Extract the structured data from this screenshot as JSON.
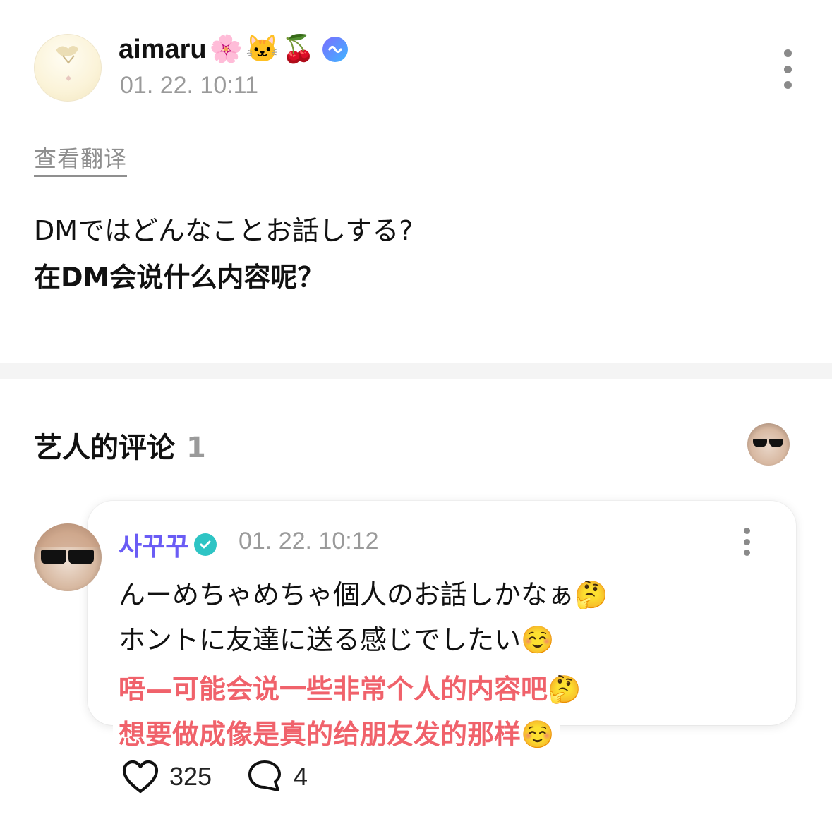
{
  "post": {
    "author_name": "aimaru",
    "author_emojis": [
      "🌸",
      "🐱",
      "🍒"
    ],
    "timestamp": "01. 22. 10:11",
    "translate_link": "查看翻译",
    "text_original": "DMではどんなことお話しする?",
    "text_translation": "在DM会说什么内容呢？"
  },
  "artist_comments": {
    "title": "艺人的评论",
    "count": "1"
  },
  "comment": {
    "author_name": "사꾸꾸",
    "timestamp": "01. 22. 10:12",
    "line1": "んーめちゃめちゃ個人のお話しかなぁ🤔",
    "line2": "ホントに友達に送る感じでしたい☺️",
    "translation_line1": "唔—可能会说一些非常个人的内容吧🤔",
    "translation_line2": "想要做成像是真的给朋友发的那样☺️",
    "like_count": "325",
    "reply_count": "4"
  },
  "icons": {
    "verified_badge": "weverse-verified-icon",
    "check_badge": "verified-check-icon",
    "more": "more-vertical-icon",
    "like": "heart-outline-icon",
    "reply": "speech-bubble-icon"
  },
  "colors": {
    "artist_name": "#6a5cf5",
    "translation_text": "#f0626b",
    "check_badge": "#2ec4c4",
    "muted_text": "#9a9a9a"
  }
}
